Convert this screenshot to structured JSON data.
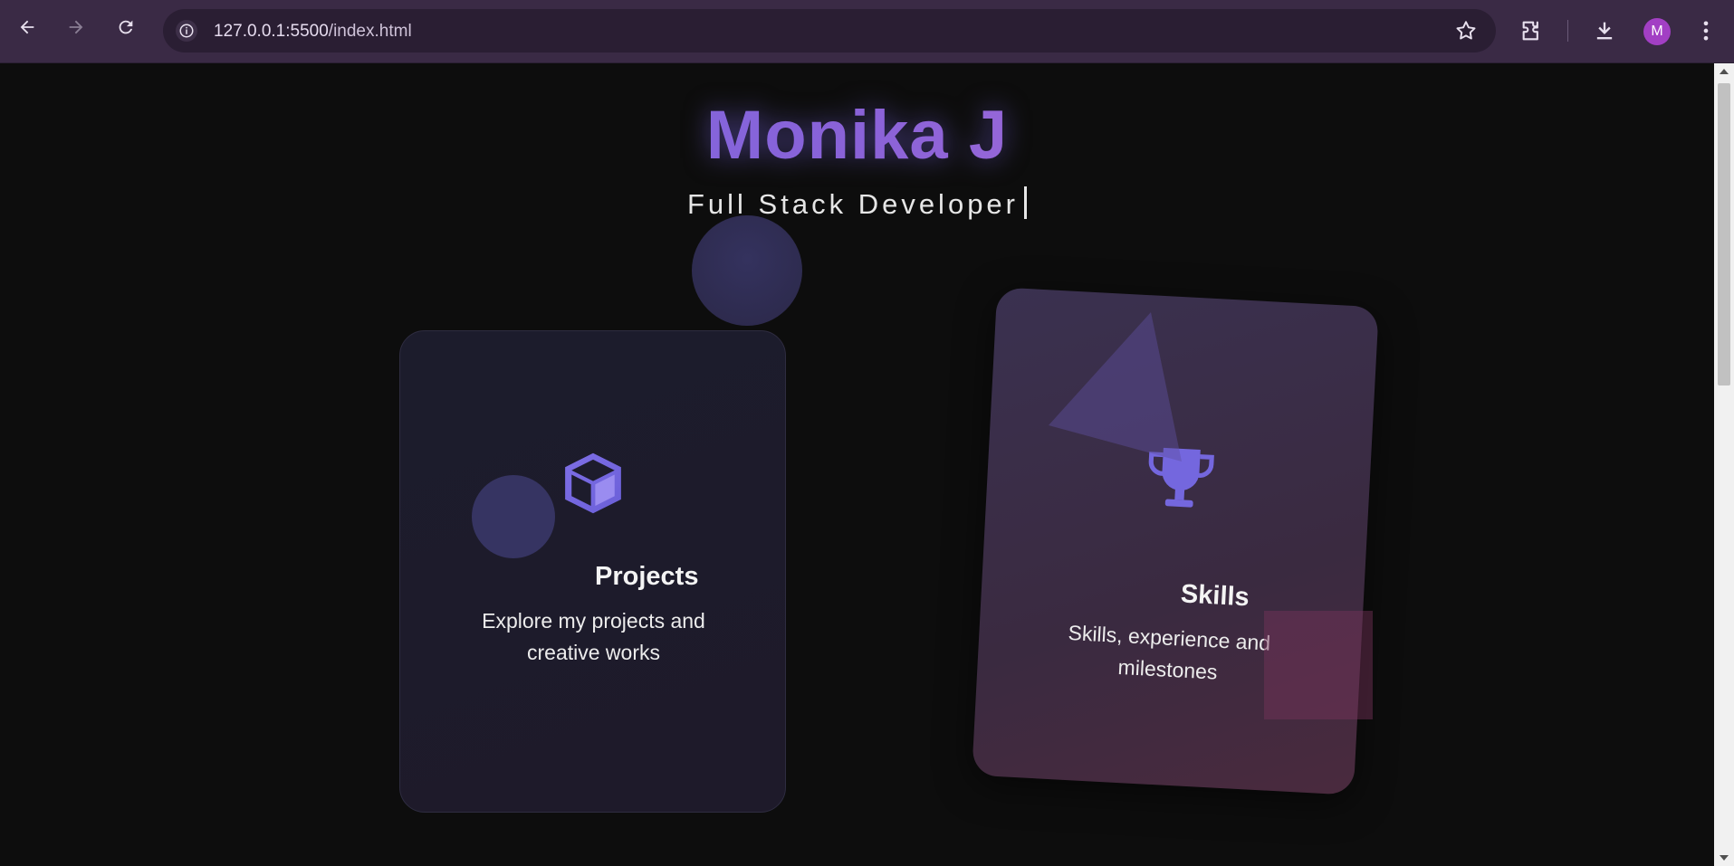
{
  "browser": {
    "url_host": "127.0.0.1:5500",
    "url_path": "/index.html",
    "profile_initial": "M",
    "icons": [
      "back-icon",
      "forward-icon",
      "reload-icon",
      "site-info-icon",
      "bookmark-star-icon",
      "extensions-icon",
      "download-icon",
      "menu-icon"
    ]
  },
  "hero": {
    "title": "Monika J",
    "subtitle": "Full Stack Developer"
  },
  "cards": {
    "projects": {
      "title": "Projects",
      "description_line1": "Explore my projects and",
      "description_line2": "creative works",
      "icon": "cube-icon"
    },
    "skills": {
      "title": "Skills",
      "description_line1": "Skills, experience and",
      "description_line2": "milestones",
      "icon": "trophy-icon"
    }
  },
  "colors": {
    "accent": "#7b6be0",
    "gradient_end": "#c77ad6",
    "background": "#0d0d0d"
  }
}
